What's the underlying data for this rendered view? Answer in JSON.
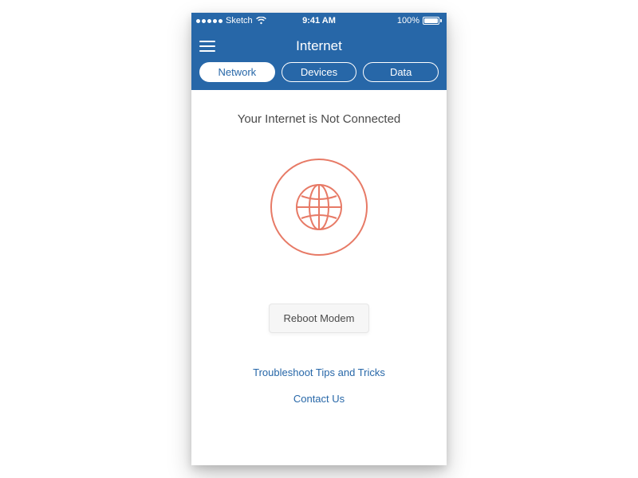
{
  "status_bar": {
    "carrier": "Sketch",
    "time": "9:41 AM",
    "battery_pct": "100%"
  },
  "header": {
    "title": "Internet"
  },
  "tabs": [
    {
      "label": "Network",
      "active": true
    },
    {
      "label": "Devices",
      "active": false
    },
    {
      "label": "Data",
      "active": false
    }
  ],
  "main": {
    "status_heading": "Your Internet is Not Connected",
    "reboot_label": "Reboot Modem"
  },
  "links": {
    "troubleshoot": "Troubleshoot Tips and Tricks",
    "contact": "Contact Us"
  },
  "colors": {
    "brand": "#2767a8",
    "accent": "#e77a66"
  }
}
